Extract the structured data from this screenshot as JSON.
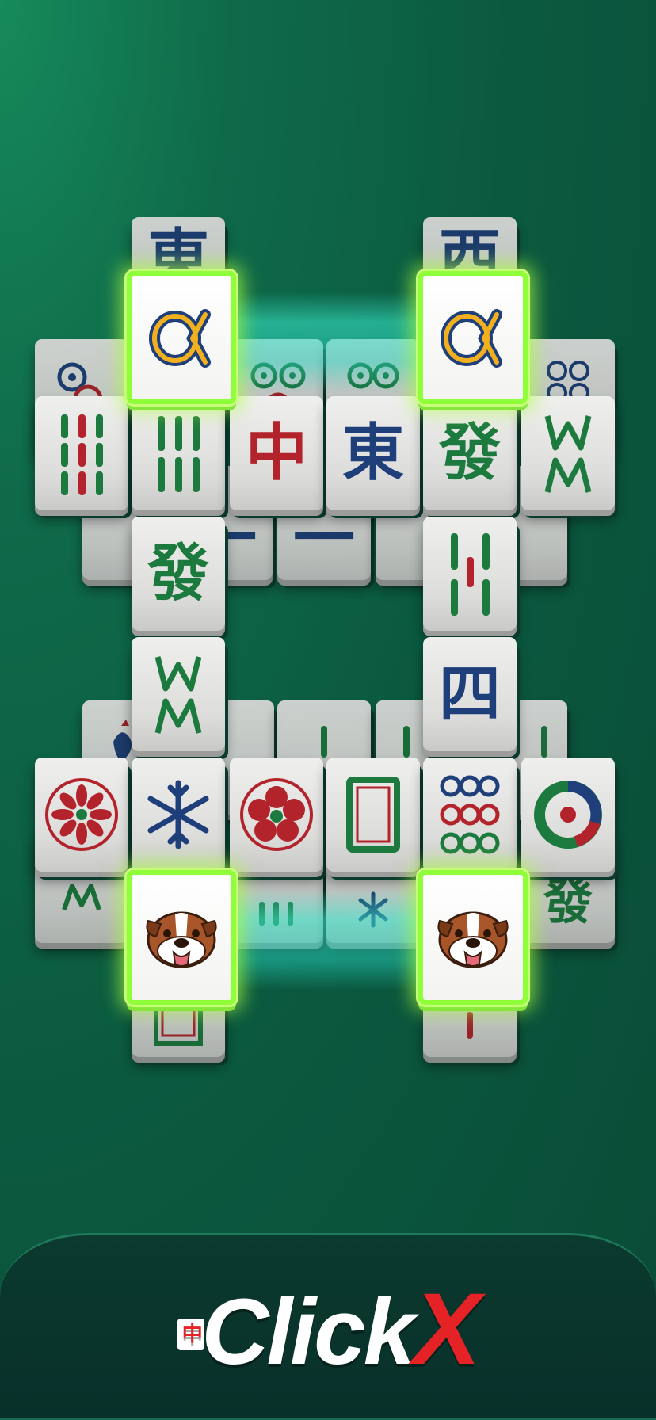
{
  "brand": {
    "logo_text": "ClickX",
    "logo_icon_char": "中",
    "accent_color": "#e52226"
  },
  "colors": {
    "tile_red": "#b3232b",
    "tile_green": "#1d7a3e",
    "tile_blue": "#1f3f7a",
    "selected_border": "#8fff39",
    "glow": "#3ff0d2"
  },
  "board": {
    "selected_pairs": [
      {
        "pair": "alpha",
        "icon": "alpha-icon"
      },
      {
        "pair": "bulldog",
        "icon": "bulldog-icon"
      }
    ],
    "tiles": [
      {
        "name": "tile-east-top",
        "face": "char",
        "text": "東",
        "color": "blue",
        "state": "partial"
      },
      {
        "name": "tile-west-top",
        "face": "char",
        "text": "西",
        "color": "blue",
        "state": "partial"
      },
      {
        "name": "tile-alpha-left",
        "face": "alpha",
        "state": "selected"
      },
      {
        "name": "tile-alpha-right",
        "face": "alpha",
        "state": "selected"
      },
      {
        "name": "tile-circle-1",
        "face": "dots",
        "state": "partial"
      },
      {
        "name": "tile-circle-2-a",
        "face": "dots",
        "state": "partial"
      },
      {
        "name": "tile-circle-2-b",
        "face": "dots",
        "state": "partial"
      },
      {
        "name": "tile-circle-4",
        "face": "dots",
        "state": "partial"
      },
      {
        "name": "tile-bamboo-9",
        "face": "bamboo",
        "state": "free"
      },
      {
        "name": "tile-bamboo-6",
        "face": "bamboo",
        "state": "free"
      },
      {
        "name": "tile-red-dragon",
        "face": "char",
        "text": "中",
        "color": "red",
        "state": "free"
      },
      {
        "name": "tile-east",
        "face": "char",
        "text": "東",
        "color": "blue",
        "state": "free"
      },
      {
        "name": "tile-green-dragon",
        "face": "char",
        "text": "發",
        "color": "green",
        "state": "free"
      },
      {
        "name": "tile-bamboo-w-right",
        "face": "bamboo",
        "state": "free"
      },
      {
        "name": "tile-green-dragon-2",
        "face": "char",
        "text": "發",
        "color": "green",
        "state": "free"
      },
      {
        "name": "tile-bamboo-5",
        "face": "bamboo",
        "state": "free"
      },
      {
        "name": "tile-bamboo-w-left",
        "face": "bamboo",
        "state": "free"
      },
      {
        "name": "tile-four",
        "face": "char",
        "text": "四",
        "color": "blue",
        "state": "free"
      },
      {
        "name": "tile-flower-red",
        "face": "flower",
        "state": "free"
      },
      {
        "name": "tile-snowflake",
        "face": "snowflake",
        "state": "free"
      },
      {
        "name": "tile-plum",
        "face": "plum",
        "state": "free"
      },
      {
        "name": "tile-white-dragon",
        "face": "frame",
        "state": "free"
      },
      {
        "name": "tile-circle-9",
        "face": "dots",
        "state": "free"
      },
      {
        "name": "tile-circle-big",
        "face": "ring",
        "state": "free"
      },
      {
        "name": "tile-bulldog-left",
        "face": "dog",
        "state": "selected"
      },
      {
        "name": "tile-bulldog-right",
        "face": "dog",
        "state": "selected"
      }
    ]
  }
}
